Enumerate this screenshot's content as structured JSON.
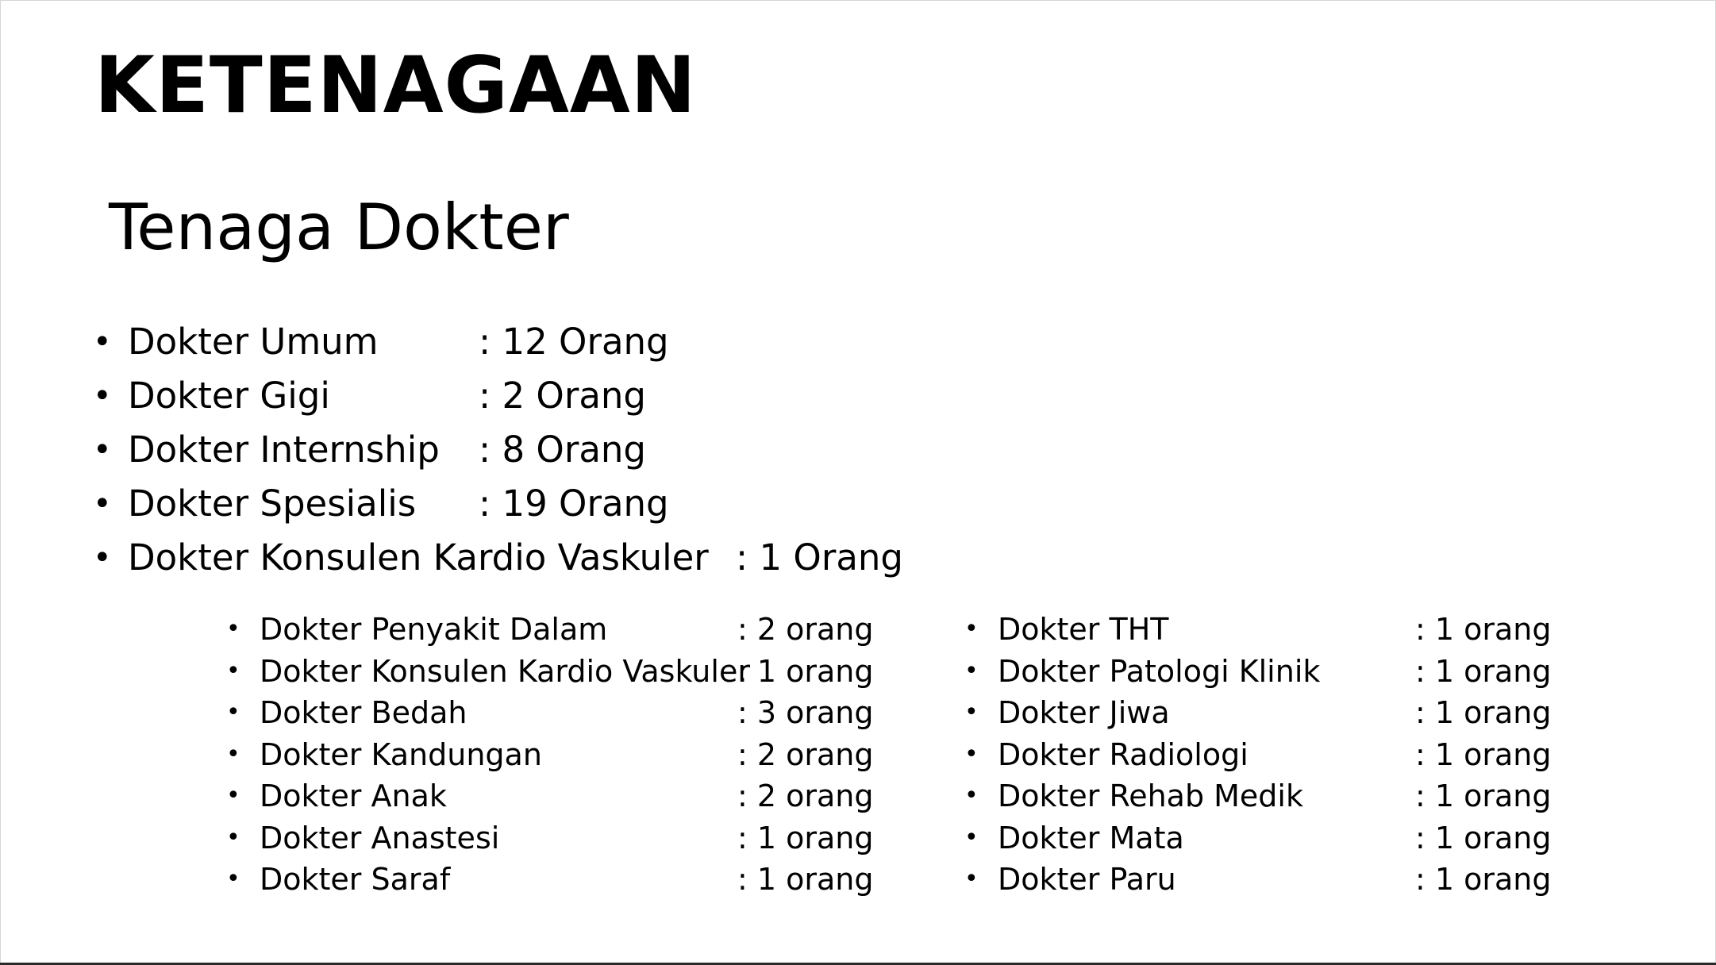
{
  "slide": {
    "title": "KETENAGAAN",
    "subtitle": "Tenaga Dokter",
    "bullet_glyph": "•",
    "main_items": [
      {
        "label": "Dokter Umum",
        "value": ": 12 Orang"
      },
      {
        "label": "Dokter Gigi",
        "value": ": 2 Orang"
      },
      {
        "label": "Dokter Internship",
        "value": ": 8 Orang"
      },
      {
        "label": "Dokter Spesialis",
        "value": ": 19 Orang"
      },
      {
        "label": "Dokter Konsulen Kardio Vaskuler",
        "value": ": 1 Orang"
      }
    ],
    "specialists_left": [
      {
        "label": "Dokter Penyakit Dalam",
        "value": ": 2 orang"
      },
      {
        "label": "Dokter Konsulen Kardio Vaskuler",
        "value": ": 1 orang"
      },
      {
        "label": "Dokter Bedah",
        "value": ": 3 orang"
      },
      {
        "label": "Dokter Kandungan",
        "value": ": 2 orang"
      },
      {
        "label": "Dokter Anak",
        "value": ": 2 orang"
      },
      {
        "label": "Dokter Anastesi",
        "value": ": 1 orang"
      },
      {
        "label": "Dokter Saraf",
        "value": ": 1 orang"
      }
    ],
    "specialists_right": [
      {
        "label": "Dokter THT",
        "value": ": 1 orang"
      },
      {
        "label": "Dokter Patologi Klinik",
        "value": ": 1 orang"
      },
      {
        "label": "Dokter Jiwa",
        "value": ": 1 orang"
      },
      {
        "label": "Dokter Radiologi",
        "value": ": 1 orang"
      },
      {
        "label": "Dokter Rehab Medik",
        "value": ": 1 orang"
      },
      {
        "label": "Dokter Mata",
        "value": ": 1 orang"
      },
      {
        "label": "Dokter Paru",
        "value": ": 1 orang"
      }
    ]
  }
}
